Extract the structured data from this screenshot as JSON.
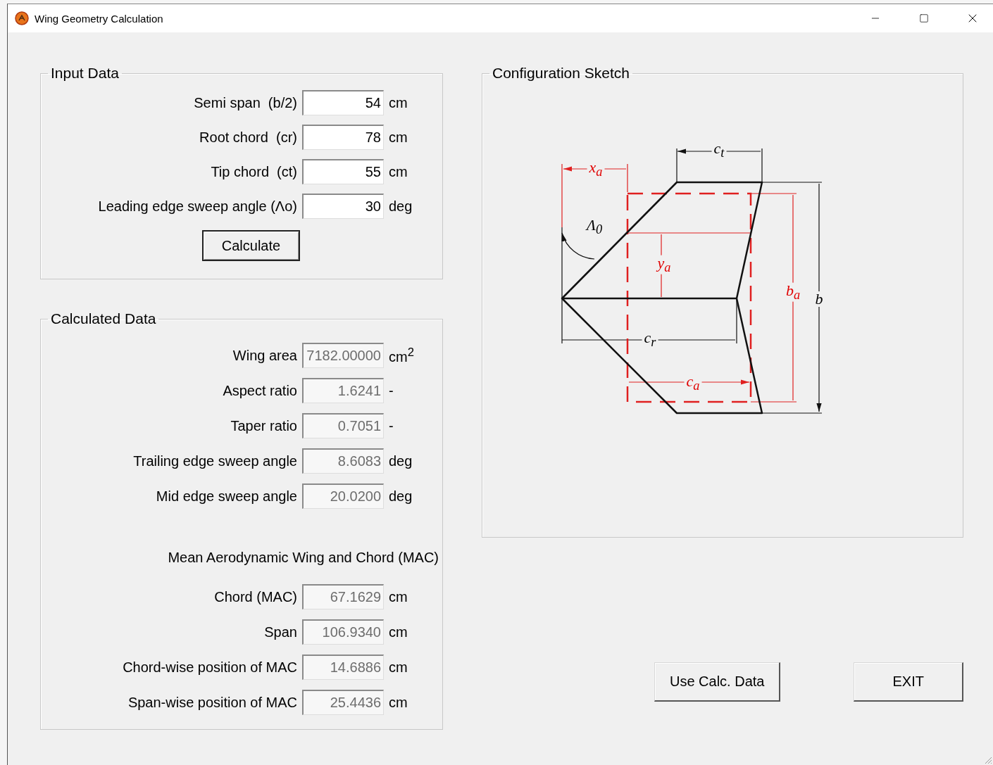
{
  "window": {
    "title": "Wing Geometry Calculation"
  },
  "input_data": {
    "title": "Input Data",
    "fields": [
      {
        "label": "Semi span  (b/2)",
        "value": "54",
        "unit": "cm"
      },
      {
        "label": "Root chord  (cr)",
        "value": "78",
        "unit": "cm"
      },
      {
        "label": "Tip chord  (ct)",
        "value": "55",
        "unit": "cm"
      },
      {
        "label": "Leading edge sweep angle (Λo)",
        "value": "30",
        "unit": "deg"
      }
    ],
    "button": "Calculate"
  },
  "calculated_data": {
    "title": "Calculated Data",
    "fields": [
      {
        "label": "Wing area",
        "value": "7182.00000",
        "unit": "cm$^{2}$",
        "disabled": true
      },
      {
        "label": "Aspect ratio",
        "value": "1.6241",
        "unit": "-",
        "disabled": true
      },
      {
        "label": "Taper ratio",
        "value": "0.7051",
        "unit": "-",
        "disabled": true
      },
      {
        "label": "Trailing edge sweep angle",
        "value": "8.6083",
        "unit": "deg",
        "disabled": true
      },
      {
        "label": "Mid edge sweep angle",
        "value": "20.0200",
        "unit": "deg",
        "disabled": true
      }
    ],
    "mac_heading": "Mean Aerodynamic Wing and Chord (MAC)",
    "mac_fields": [
      {
        "label": "Chord (MAC)",
        "value": "67.1629",
        "unit": "cm",
        "disabled": true
      },
      {
        "label": "Span",
        "value": "106.9340",
        "unit": "cm",
        "disabled": true
      },
      {
        "label": "Chord-wise position of MAC",
        "value": "14.6886",
        "unit": "cm",
        "disabled": true
      },
      {
        "label": "Span-wise position of MAC",
        "value": "25.4436",
        "unit": "cm",
        "disabled": true
      }
    ]
  },
  "sketch": {
    "title": "Configuration Sketch",
    "labels": [
      {
        "text": "c$_{t}$",
        "color": "#000000"
      },
      {
        "text": "x$_{a}$",
        "color": "#e00000"
      },
      {
        "text": "Λ$_{0}$",
        "color": "#000000"
      },
      {
        "text": "y$_{a}$",
        "color": "#e00000"
      },
      {
        "text": "b$_{a}$",
        "color": "#e00000"
      },
      {
        "text": "b",
        "color": "#000000"
      },
      {
        "text": "c$_{r}$",
        "color": "#000000"
      },
      {
        "text": "c$_{a}$",
        "color": "#e00000"
      }
    ]
  },
  "buttons": [
    "Use Calc. Data",
    "EXIT"
  ]
}
